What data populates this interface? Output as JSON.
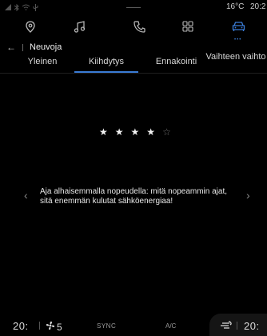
{
  "status_bar": {
    "temperature": "16°C",
    "time": "20:2"
  },
  "top_nav": {
    "items": [
      {
        "icon": "location-pin-icon"
      },
      {
        "icon": "music-note-icon"
      },
      {
        "icon": "phone-icon"
      },
      {
        "icon": "apps-grid-icon"
      },
      {
        "icon": "car-icon",
        "active": true
      }
    ],
    "active_color": "#3a7bd5"
  },
  "breadcrumb": {
    "title": "Neuvoja"
  },
  "tabs": [
    {
      "label": "Yleinen"
    },
    {
      "label": "Kiihdytys",
      "selected": true
    },
    {
      "label": "Ennakointi"
    },
    {
      "label": "Vaihteen vaihto"
    }
  ],
  "rating": {
    "value": 4,
    "max": 5
  },
  "advice": {
    "text": "Aja alhaisemmalla nopeudella: mitä nopeammin ajat, sitä enemmän kulutat sähköenergiaa!"
  },
  "climate": {
    "left_temp": "20:",
    "fan_speed": "5",
    "sync_label": "SYNC",
    "ac_label": "A/C",
    "right_temp": "20:"
  }
}
